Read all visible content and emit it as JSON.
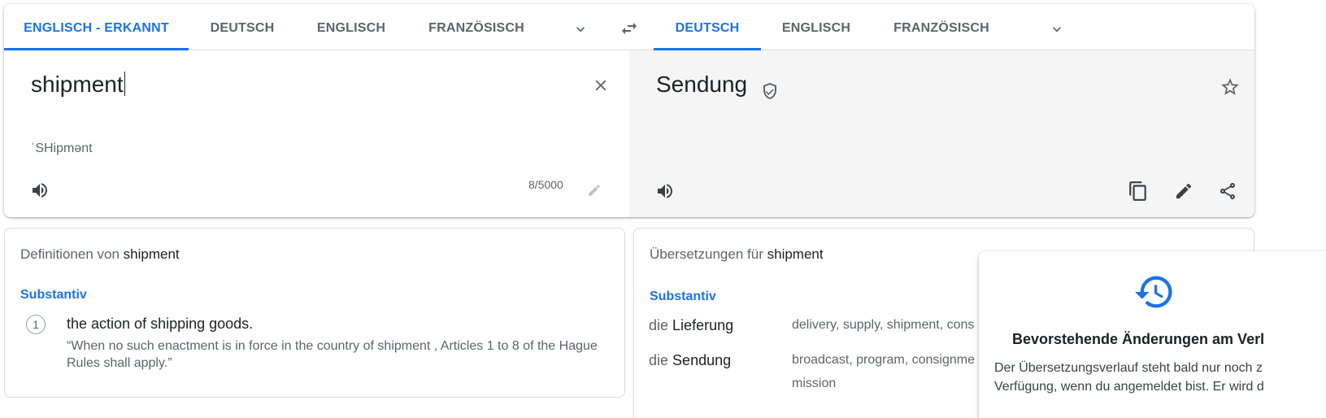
{
  "source_langs": {
    "tabs": [
      "ENGLISCH - ERKANNT",
      "DEUTSCH",
      "ENGLISCH",
      "FRANZÖSISCH"
    ],
    "active": 0
  },
  "target_langs": {
    "tabs": [
      "DEUTSCH",
      "ENGLISCH",
      "FRANZÖSISCH"
    ],
    "active": 0
  },
  "source": {
    "text": "shipment",
    "transliteration": "ˈSHipmənt",
    "char_count": "8/5000"
  },
  "target": {
    "text": "Sendung"
  },
  "definitions": {
    "heading_prefix": "Definitionen von",
    "heading_word": "shipment",
    "pos": "Substantiv",
    "items": [
      {
        "num": "1",
        "text": "the action of shipping goods.",
        "example": "“When no such enactment is in force in the country of shipment , Articles 1 to 8 of the Hague Rules shall apply.”"
      }
    ]
  },
  "translations": {
    "heading_prefix": "Übersetzungen für",
    "heading_word": "shipment",
    "pos": "Substantiv",
    "rows": [
      {
        "article": "die",
        "word": "Lieferung",
        "synonyms": "delivery, supply, shipment, cons"
      },
      {
        "article": "die",
        "word": "Sendung",
        "synonyms": "broadcast, program, consignme",
        "synonyms2": "mission"
      }
    ]
  },
  "history_popup": {
    "title": "Bevorstehende Änderungen am Verl",
    "body_line1": "Der Übersetzungsverlauf steht bald nur noch z",
    "body_line2": "Verfügung, wenn du angemeldet bist. Er wird d"
  },
  "colors": {
    "accent": "#1a73e8",
    "muted": "#5f6368",
    "target_bg": "#f5f5f5"
  },
  "icons": {
    "source_dropdown": "chevron-down-icon",
    "swap": "swap-icon",
    "target_dropdown": "chevron-down-icon",
    "clear": "close-icon",
    "verified": "shield-check-icon",
    "star": "star-icon",
    "source_listen": "speaker-icon",
    "edit_source": "pencil-icon",
    "target_listen": "speaker-icon",
    "copy": "copy-icon",
    "edit": "pencil-icon",
    "share": "share-icon",
    "history": "history-icon"
  }
}
